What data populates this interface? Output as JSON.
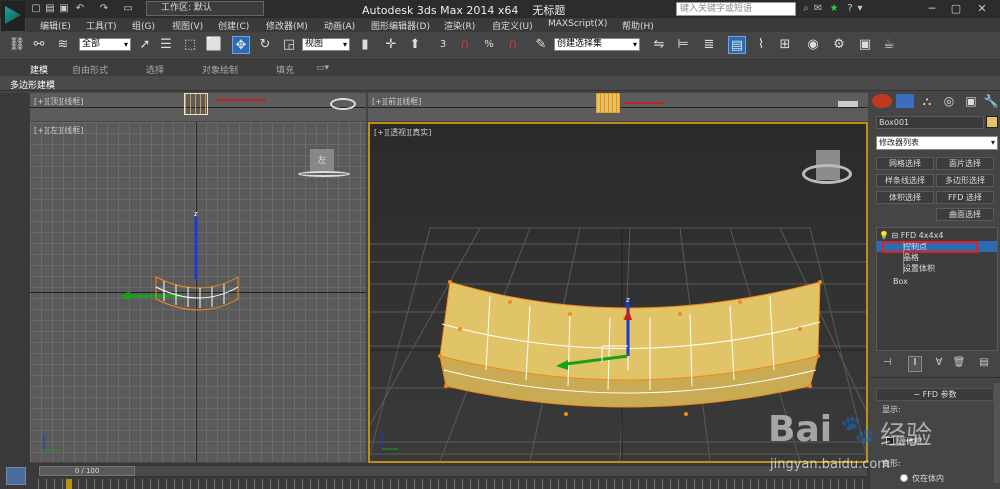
{
  "titlebar": {
    "workspace_label": "工作区: 默认",
    "app_title": "Autodesk 3ds Max  2014 x64",
    "doc_title": "无标题",
    "search_placeholder": "键入关键字或短语"
  },
  "menu": [
    "编辑(E)",
    "工具(T)",
    "组(G)",
    "视图(V)",
    "创建(C)",
    "修改器(M)",
    "动画(A)",
    "图形编辑器(D)",
    "渲染(R)",
    "自定义(U)",
    "MAXScript(X)",
    "帮助(H)"
  ],
  "toolbar": {
    "selection_filter": "全部",
    "ref_coord": "视图",
    "named_selection": "创建选择集",
    "percent_label": "%",
    "snap_label": "3"
  },
  "ribbon": {
    "tabs": [
      "建模",
      "自由形式",
      "选择",
      "对象绘制",
      "填充"
    ],
    "sub_label": "多边形建模"
  },
  "viewports": {
    "top": "[+][顶][线框]",
    "front": "[+][前][线框]",
    "left": "[+][左][线框]",
    "persp": "[+][透视][真实]",
    "left_cube_label": "左"
  },
  "cmdpanel": {
    "object_name": "Box001",
    "modifier_list": "修改器列表",
    "buttons": [
      "网格选择",
      "面片选择",
      "样条线选择",
      "多边形选择",
      "体积选择",
      "FFD 选择",
      "曲面选择"
    ],
    "stack": {
      "ffd": "FFD 4x4x4",
      "control_points": "控制点",
      "lattice": "晶格",
      "set_volume": "设置体积",
      "box": "Box"
    },
    "rollout_title": "FFD 参数",
    "display_label": "显示:",
    "source_volume_label": "源体积",
    "deform_label": "变形:",
    "only_in_volume_label": "仅在体内"
  },
  "timeline": {
    "frame_counter": "0 / 100"
  },
  "watermark": {
    "brand": "Bai",
    "brand2": "经验",
    "url": "jingyan.baidu.com"
  },
  "colors": {
    "accent_blue": "#2e6ab2",
    "highlight_red": "#e02020",
    "box_yellow": "#e2c468",
    "box_orange": "#f08a1c",
    "selection_gold": "#b89218"
  }
}
